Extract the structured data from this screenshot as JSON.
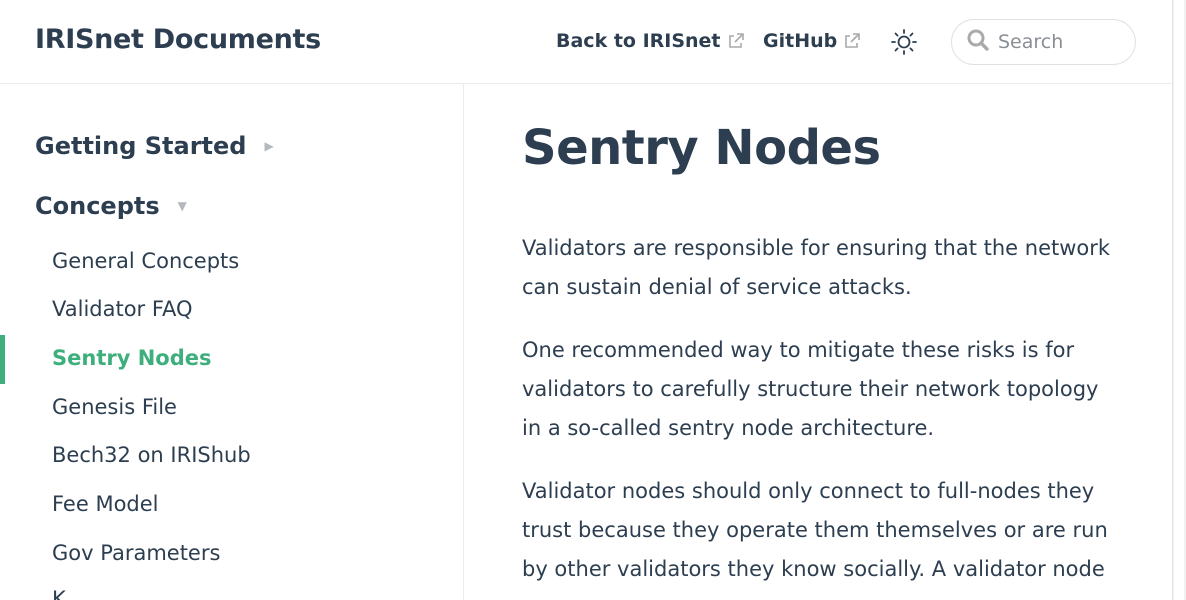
{
  "header": {
    "site_title": "IRISnet Documents",
    "links": [
      {
        "label": "Back to IRISnet",
        "icon": "external-link-icon"
      },
      {
        "label": "GitHub",
        "icon": "external-link-icon"
      }
    ],
    "theme_icon": "sun-icon",
    "search": {
      "placeholder": "Search",
      "value": "",
      "icon": "search-icon"
    }
  },
  "sidebar": {
    "groups": [
      {
        "label": "Getting Started",
        "state": "collapsed"
      },
      {
        "label": "Concepts",
        "state": "expanded"
      }
    ],
    "items": [
      {
        "label": "General Concepts"
      },
      {
        "label": "Validator FAQ"
      },
      {
        "label": "Sentry Nodes",
        "active": true
      },
      {
        "label": "Genesis File"
      },
      {
        "label": "Bech32 on IRIShub"
      },
      {
        "label": "Fee Model"
      },
      {
        "label": "Gov Parameters"
      },
      {
        "label": "K"
      }
    ],
    "accent": "#3eaf7c"
  },
  "main": {
    "title": "Sentry Nodes",
    "paragraphs": [
      "Validators are responsible for ensuring that the network can sustain denial of service attacks.",
      "One recommended way to mitigate these risks is for validators to carefully structure their network topology in a so-called sentry node architecture.",
      "Validator nodes should only connect to full-nodes they trust because they operate them themselves or are run by other validators they know socially. A validator node"
    ]
  }
}
